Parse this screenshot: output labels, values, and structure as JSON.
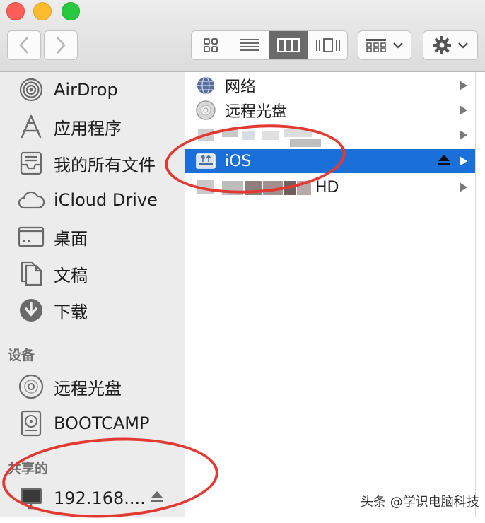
{
  "window": {
    "traffic_lights": [
      "close",
      "minimize",
      "zoom"
    ]
  },
  "toolbar": {
    "nav": {
      "back_icon": "chevron-left-icon",
      "forward_icon": "chevron-right-icon"
    },
    "view_modes": [
      "icon-view",
      "list-view",
      "column-view",
      "coverflow-view"
    ],
    "active_view": "column-view",
    "arrange_icon": "arrange-grid-icon",
    "action_icon": "gear-icon"
  },
  "sidebar": {
    "favorites": [
      {
        "label": "AirDrop",
        "icon": "airdrop-icon"
      },
      {
        "label": "应用程序",
        "icon": "applications-icon"
      },
      {
        "label": "我的所有文件",
        "icon": "all-files-icon"
      },
      {
        "label": "iCloud Drive",
        "icon": "cloud-icon"
      },
      {
        "label": "桌面",
        "icon": "desktop-icon"
      },
      {
        "label": "文稿",
        "icon": "documents-icon"
      },
      {
        "label": "下载",
        "icon": "download-icon"
      }
    ],
    "devices_header": "设备",
    "devices": [
      {
        "label": "远程光盘",
        "icon": "disc-icon"
      },
      {
        "label": "BOOTCAMP",
        "icon": "hard-drive-icon"
      }
    ],
    "shared_header": "共享的",
    "shared": [
      {
        "label": "192.168....",
        "icon": "display-icon"
      }
    ]
  },
  "column": {
    "items": [
      {
        "label": "网络",
        "icon": "network-globe-icon"
      },
      {
        "label": "远程光盘",
        "icon": "disc-icon"
      },
      {
        "label": "",
        "icon": "drive-icon"
      },
      {
        "label": "iOS",
        "icon": "external-drive-icon",
        "selected": true
      },
      {
        "label": "HD",
        "icon": "drive-icon"
      }
    ]
  },
  "watermark": "头条 @学识电脑科技",
  "colors": {
    "selection": "#1b6fd9",
    "annotation": "#e23a32"
  }
}
